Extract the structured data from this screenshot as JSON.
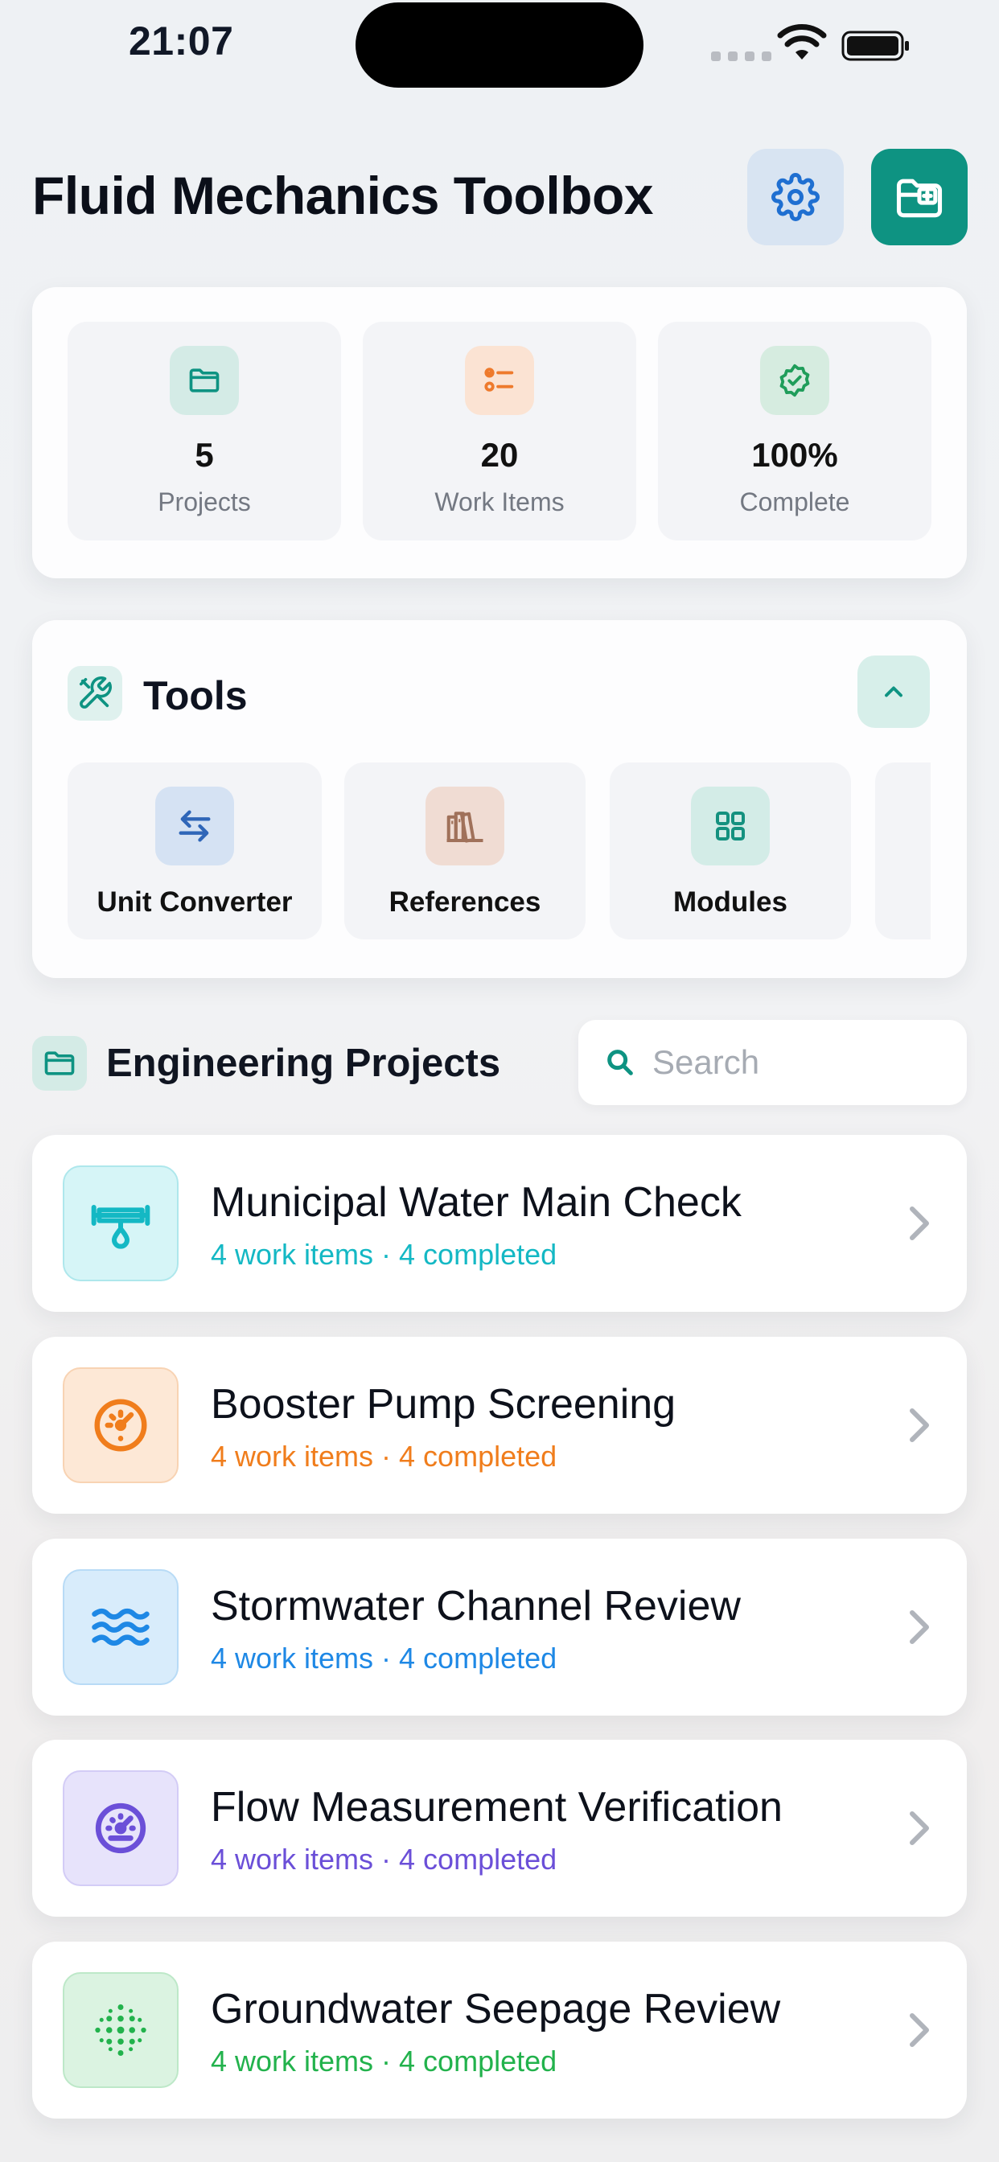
{
  "status_bar": {
    "time": "21:07"
  },
  "header": {
    "title": "Fluid Mechanics Toolbox"
  },
  "stats": [
    {
      "value": "5",
      "label": "Projects",
      "icon": "folder-icon",
      "color": "#0e9382"
    },
    {
      "value": "20",
      "label": "Work Items",
      "icon": "checklist-icon",
      "color": "#ee7a2c"
    },
    {
      "value": "100%",
      "label": "Complete",
      "icon": "verified-badge-icon",
      "color": "#1f9d5a"
    }
  ],
  "tools": {
    "title": "Tools",
    "items": [
      {
        "label": "Unit Converter",
        "icon": "arrows-swap-icon",
        "color": "#2f66b8"
      },
      {
        "label": "References",
        "icon": "books-icon",
        "color": "#a0715a"
      },
      {
        "label": "Modules",
        "icon": "grid-icon",
        "color": "#14917f"
      }
    ]
  },
  "projects": {
    "title": "Engineering Projects",
    "search_placeholder": "Search",
    "items": [
      {
        "name": "Municipal Water Main Check",
        "subtitle": "4 work items · 4 completed",
        "icon": "pipe-drop-icon",
        "color": "#14b8c4"
      },
      {
        "name": "Booster Pump Screening",
        "subtitle": "4 work items · 4 completed",
        "icon": "gauge-icon",
        "color": "#f07d1c"
      },
      {
        "name": "Stormwater Channel Review",
        "subtitle": "4 work items · 4 completed",
        "icon": "waves-icon",
        "color": "#1e88e5"
      },
      {
        "name": "Flow Measurement Verification",
        "subtitle": "4 work items · 4 completed",
        "icon": "meter-icon",
        "color": "#6b4fd8"
      },
      {
        "name": "Groundwater Seepage Review",
        "subtitle": "4 work items · 4 completed",
        "icon": "dots-icon",
        "color": "#22b24c"
      }
    ]
  }
}
